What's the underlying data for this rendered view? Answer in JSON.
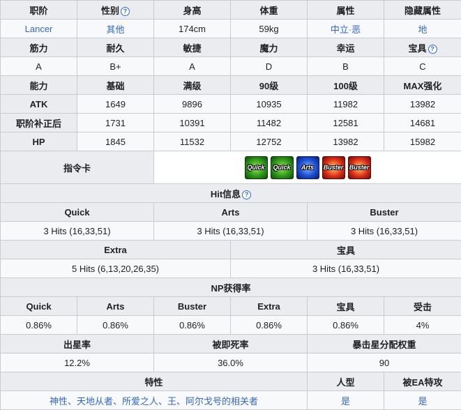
{
  "basic": {
    "headers": [
      "职阶",
      "性别",
      "身高",
      "体重",
      "属性",
      "隐藏属性"
    ],
    "values": [
      "Lancer",
      "其他",
      "174cm",
      "59kg",
      "中立·恶",
      "地"
    ]
  },
  "params": {
    "headers": [
      "筋力",
      "耐久",
      "敏捷",
      "魔力",
      "幸运",
      "宝具"
    ],
    "values": [
      "A",
      "B+",
      "A",
      "D",
      "B",
      "C"
    ]
  },
  "stats": {
    "headers": [
      "能力",
      "基础",
      "满级",
      "90级",
      "100级",
      "MAX强化"
    ],
    "rows": [
      {
        "label": "ATK",
        "values": [
          "1649",
          "9896",
          "10935",
          "11982",
          "13982"
        ]
      },
      {
        "label": "职阶补正后",
        "values": [
          "1731",
          "10391",
          "11482",
          "12581",
          "14681"
        ]
      },
      {
        "label": "HP",
        "values": [
          "1845",
          "11532",
          "12752",
          "13982",
          "15982"
        ]
      }
    ]
  },
  "command_cards": {
    "label": "指令卡",
    "cards": [
      {
        "type": "quick",
        "text": "Quick",
        "icon": "quick-card-icon"
      },
      {
        "type": "quick",
        "text": "Quick",
        "icon": "quick-card-icon"
      },
      {
        "type": "arts",
        "text": "Arts",
        "icon": "arts-card-icon"
      },
      {
        "type": "buster",
        "text": "Buster",
        "icon": "buster-card-icon"
      },
      {
        "type": "buster",
        "text": "Buster",
        "icon": "buster-card-icon"
      }
    ]
  },
  "hits": {
    "title": "Hit信息",
    "headers": [
      "Quick",
      "Arts",
      "Buster"
    ],
    "values": [
      "3 Hits (16,33,51)",
      "3 Hits (16,33,51)",
      "3 Hits (16,33,51)"
    ],
    "headers2": [
      "Extra",
      "宝具"
    ],
    "values2": [
      "5 Hits (6,13,20,26,35)",
      "3 Hits (16,33,51)"
    ]
  },
  "np": {
    "title": "NP获得率",
    "headers": [
      "Quick",
      "Arts",
      "Buster",
      "Extra",
      "宝具",
      "受击"
    ],
    "values": [
      "0.86%",
      "0.86%",
      "0.86%",
      "0.86%",
      "0.86%",
      "4%"
    ]
  },
  "star": {
    "headers": [
      "出星率",
      "被即死率",
      "暴击星分配权重"
    ],
    "values": [
      "12.2%",
      "36.0%",
      "90"
    ]
  },
  "traits": {
    "headers": [
      "特性",
      "人型",
      "被EA特攻"
    ],
    "values": [
      "神性、天地从者、所爱之人、王、阿尔戈号的相关者",
      "是",
      "是"
    ]
  },
  "help_glyph": "?",
  "colors": {
    "link": "#3366cc",
    "header_bg": "#eaecf0",
    "cell_bg": "#f8f9fa",
    "border": "#c8ccd1"
  }
}
